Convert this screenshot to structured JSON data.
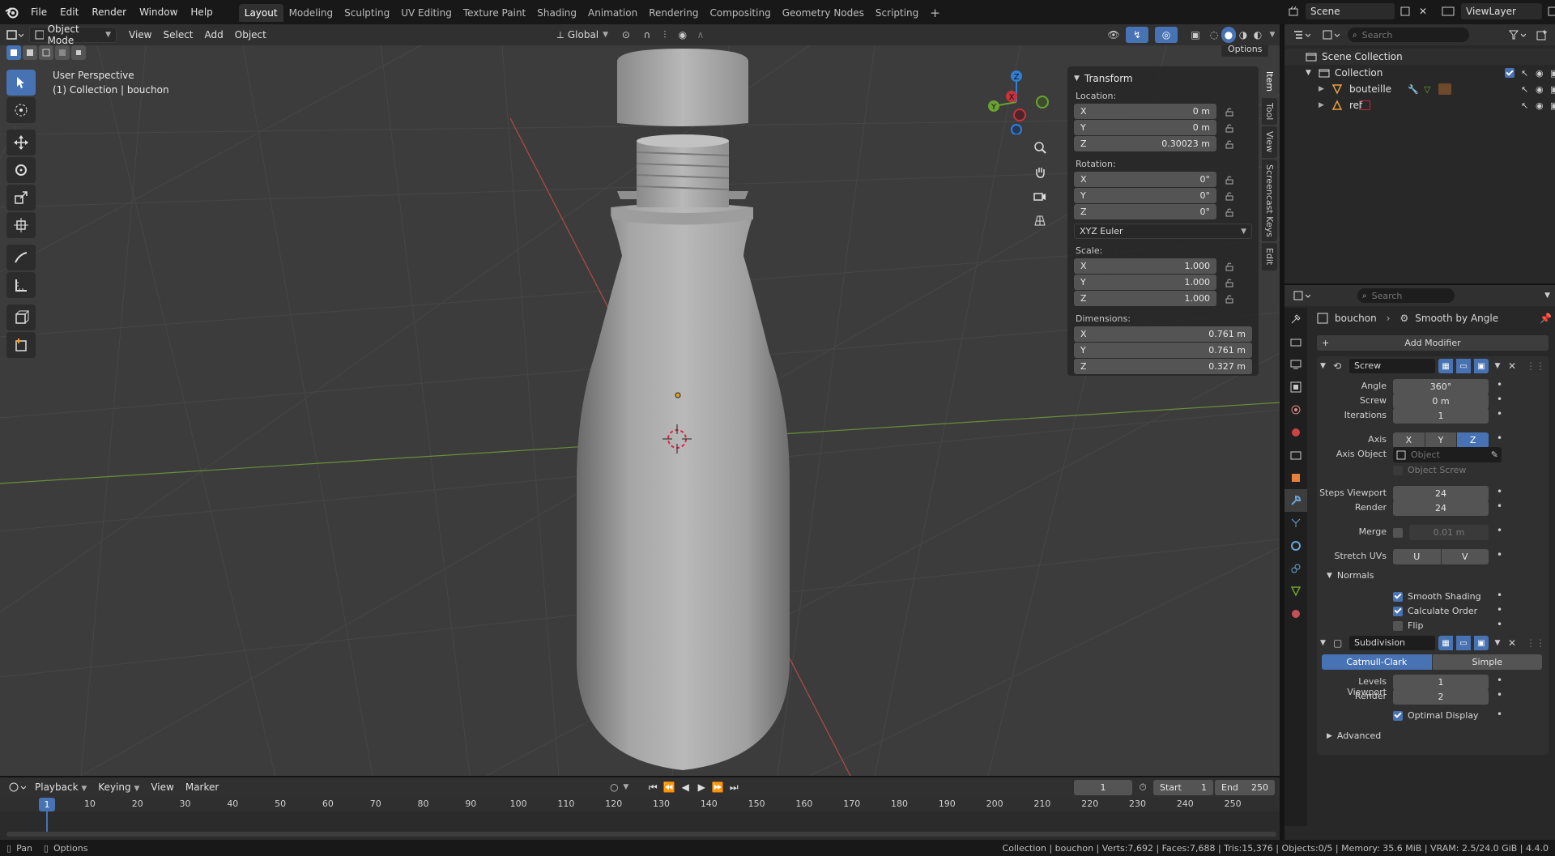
{
  "topbar": {
    "menus": [
      "File",
      "Edit",
      "Render",
      "Window",
      "Help"
    ],
    "workspaces": [
      "Layout",
      "Modeling",
      "Sculpting",
      "UV Editing",
      "Texture Paint",
      "Shading",
      "Animation",
      "Rendering",
      "Compositing",
      "Geometry Nodes",
      "Scripting"
    ],
    "active_workspace": "Layout",
    "scene": "Scene",
    "view_layer": "ViewLayer"
  },
  "viewport_header": {
    "mode": "Object Mode",
    "menus": [
      "View",
      "Select",
      "Add",
      "Object"
    ],
    "orientation": "Global",
    "options": "Options"
  },
  "viewport": {
    "perspective": "User Perspective",
    "collection_info": "(1) Collection | bouchon",
    "gizmo_axes": {
      "x": "X",
      "y": "Y",
      "z": "Z"
    }
  },
  "npanel": {
    "header": "Transform",
    "location_label": "Location:",
    "location": [
      {
        "axis": "X",
        "value": "0 m"
      },
      {
        "axis": "Y",
        "value": "0 m"
      },
      {
        "axis": "Z",
        "value": "0.30023 m"
      }
    ],
    "rotation_label": "Rotation:",
    "rotation": [
      {
        "axis": "X",
        "value": "0°"
      },
      {
        "axis": "Y",
        "value": "0°"
      },
      {
        "axis": "Z",
        "value": "0°"
      }
    ],
    "rotation_mode": "XYZ Euler",
    "scale_label": "Scale:",
    "scale": [
      {
        "axis": "X",
        "value": "1.000"
      },
      {
        "axis": "Y",
        "value": "1.000"
      },
      {
        "axis": "Z",
        "value": "1.000"
      }
    ],
    "dimensions_label": "Dimensions:",
    "dimensions": [
      {
        "axis": "X",
        "value": "0.761 m"
      },
      {
        "axis": "Y",
        "value": "0.761 m"
      },
      {
        "axis": "Z",
        "value": "0.327 m"
      }
    ],
    "tabs": [
      "Item",
      "Tool",
      "View",
      "Screencast Keys",
      "Edit"
    ]
  },
  "outliner": {
    "search_placeholder": "Search",
    "scene_collection": "Scene Collection",
    "collection": "Collection",
    "objects": [
      "bouteille",
      "ref"
    ]
  },
  "properties": {
    "search_placeholder": "Search",
    "object": "bouchon",
    "modifier_path": "Smooth by Angle",
    "add_modifier": "Add Modifier",
    "screw": {
      "name": "Screw",
      "angle_label": "Angle",
      "angle": "360°",
      "screw_label": "Screw",
      "screw": "0 m",
      "iterations_label": "Iterations",
      "iterations": "1",
      "axis_label": "Axis",
      "axis_options": [
        "X",
        "Y",
        "Z"
      ],
      "axis_selected": "Z",
      "axis_object_label": "Axis Object",
      "axis_object_placeholder": "Object",
      "object_screw": "Object Screw",
      "steps_viewport_label": "Steps Viewport",
      "steps_viewport": "24",
      "render_label": "Render",
      "render": "24",
      "merge_label": "Merge",
      "merge": "0.01 m",
      "stretch_uvs_label": "Stretch UVs",
      "stretch_u": "U",
      "stretch_v": "V",
      "normals_label": "Normals",
      "smooth_shading": "Smooth Shading",
      "calculate_order": "Calculate Order",
      "flip": "Flip"
    },
    "subdivision": {
      "name": "Subdivision",
      "mode_a": "Catmull-Clark",
      "mode_b": "Simple",
      "levels_viewport_label": "Levels Viewport",
      "levels_viewport": "1",
      "render_label": "Render",
      "render": "2",
      "optimal_display": "Optimal Display",
      "advanced": "Advanced"
    }
  },
  "timeline": {
    "menus": [
      "Playback",
      "Keying",
      "View",
      "Marker"
    ],
    "current_frame": "1",
    "start_label": "Start",
    "start": "1",
    "end_label": "End",
    "end": "250",
    "ruler": [
      "1",
      "10",
      "20",
      "30",
      "40",
      "50",
      "60",
      "70",
      "80",
      "90",
      "100",
      "110",
      "120",
      "130",
      "140",
      "150",
      "160",
      "170",
      "180",
      "190",
      "200",
      "210",
      "220",
      "230",
      "240",
      "250"
    ]
  },
  "statusbar": {
    "pan": "Pan",
    "options": "Options",
    "stats": "Collection | bouchon | Verts:7,692 | Faces:7,688 | Tris:15,376 | Objects:0/5 | Memory: 35.6 MiB | VRAM: 2.5/24.0 GiB | 4.4.0"
  },
  "colors": {
    "accent": "#4772b3",
    "axis_x": "#c8323c",
    "axis_y": "#6aa232",
    "axis_z": "#2f7fd6"
  }
}
